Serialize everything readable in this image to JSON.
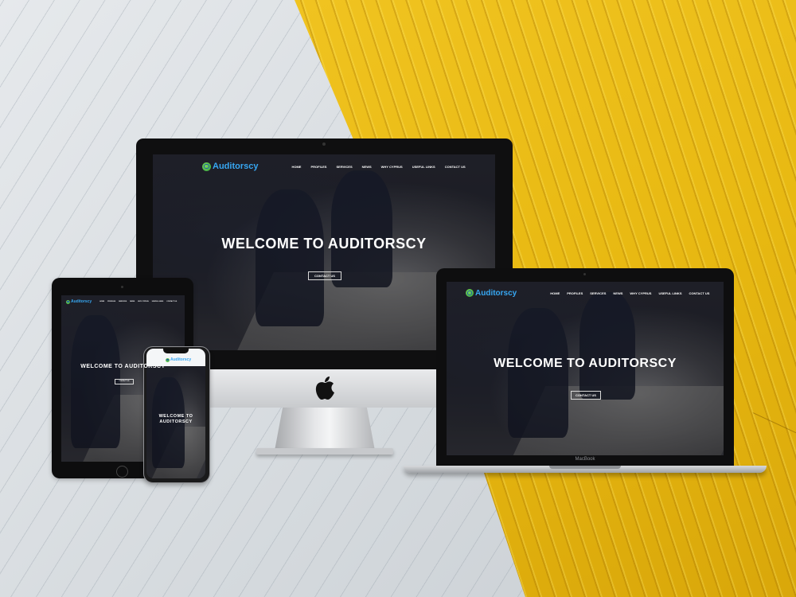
{
  "site": {
    "logo_text": "Auditorscy",
    "menu": [
      "HOME",
      "PROFILES",
      "SERVICES",
      "NEWS",
      "WHY CYPRUS",
      "USEFUL LINKS",
      "CONTACT US"
    ],
    "hero_title": "WELCOME TO AUDITORSCY",
    "hero_title_wrap": [
      "WELCOME TO",
      "AUDITORSCY"
    ],
    "cta_label": "CONTACT US"
  },
  "devices": {
    "laptop_brand": "MacBook"
  },
  "colors": {
    "accent_blue": "#37a7f2",
    "background_yellow": "#f2c624",
    "background_gray": "#d9dde0",
    "site_dark": "#25262d"
  },
  "icons": {
    "brand": "apple-logo-icon",
    "logo": "globe-logo-icon"
  }
}
